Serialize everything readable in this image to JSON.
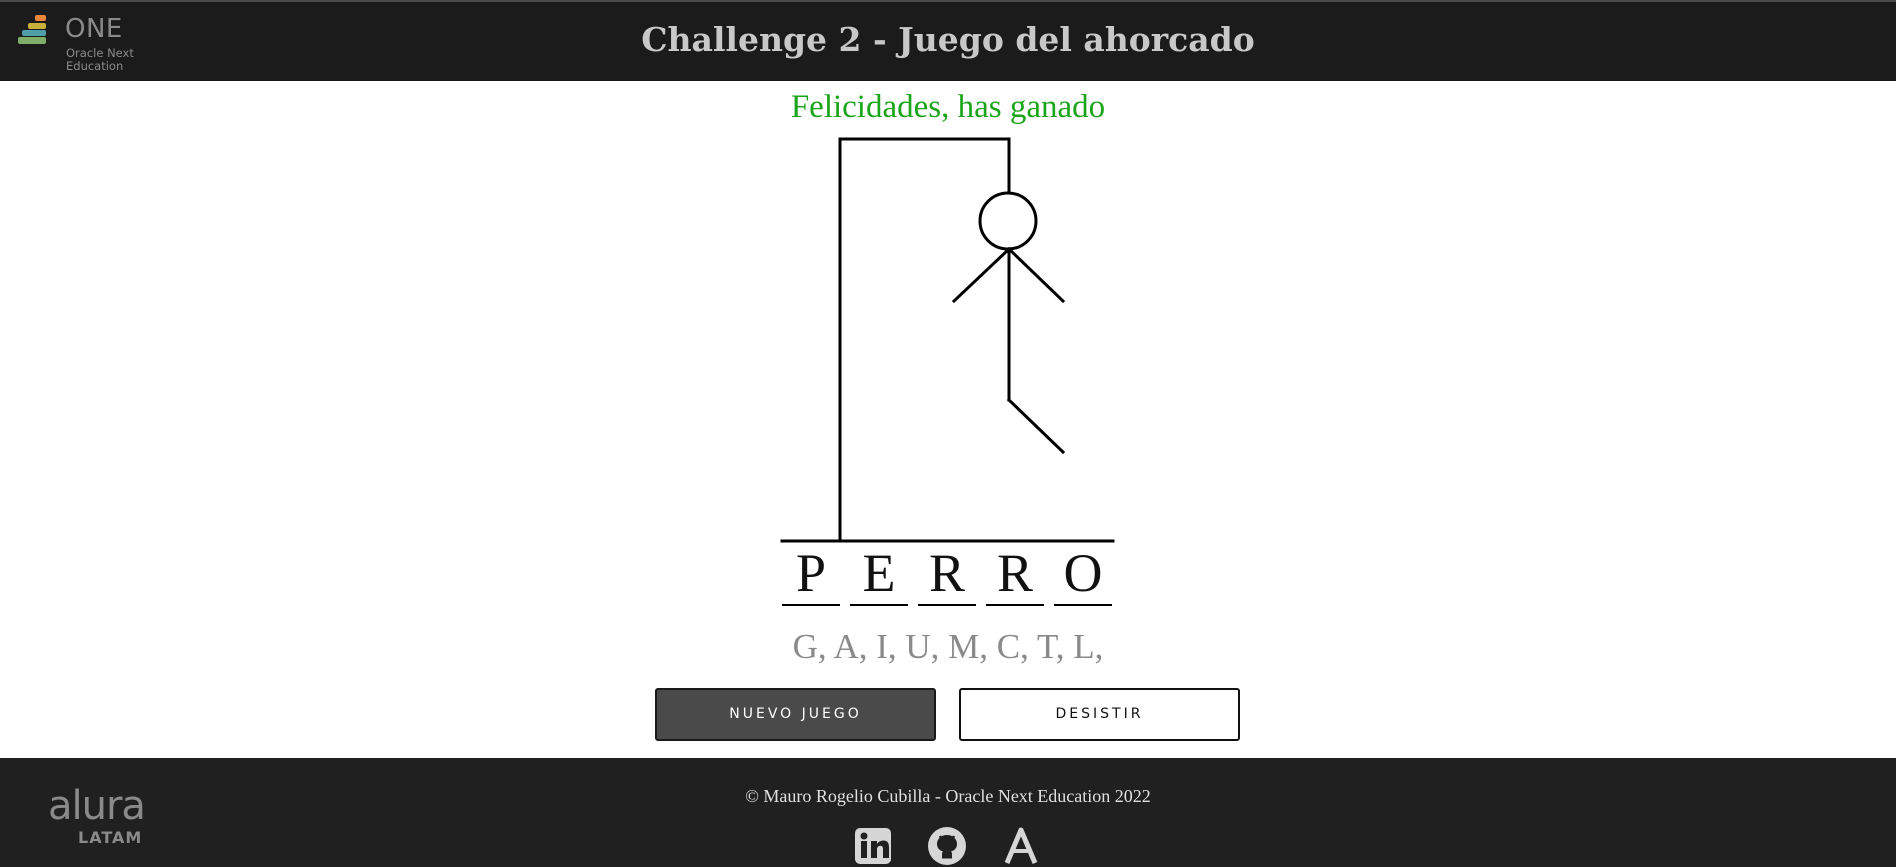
{
  "header": {
    "title": "Challenge 2 - Juego del ahorcado",
    "logo": {
      "word": "ONE",
      "subtitle": "Oracle Next Education"
    }
  },
  "game": {
    "status_message": "Felicidades, has ganado",
    "status_color": "#1aa51a",
    "word_letters": [
      "P",
      "E",
      "R",
      "R",
      "O"
    ],
    "wrong_letters": "G, A, I, U, M, C, T, L,"
  },
  "buttons": {
    "new_game": "NUEVO JUEGO",
    "give_up": "DESISTIR"
  },
  "footer": {
    "logo_word": "alura",
    "logo_sub": "LATAM",
    "copyright": "© Mauro Rogelio Cubilla - Oracle Next Education 2022",
    "social_icons": [
      "linkedin-icon",
      "github-icon",
      "alura-icon"
    ]
  }
}
